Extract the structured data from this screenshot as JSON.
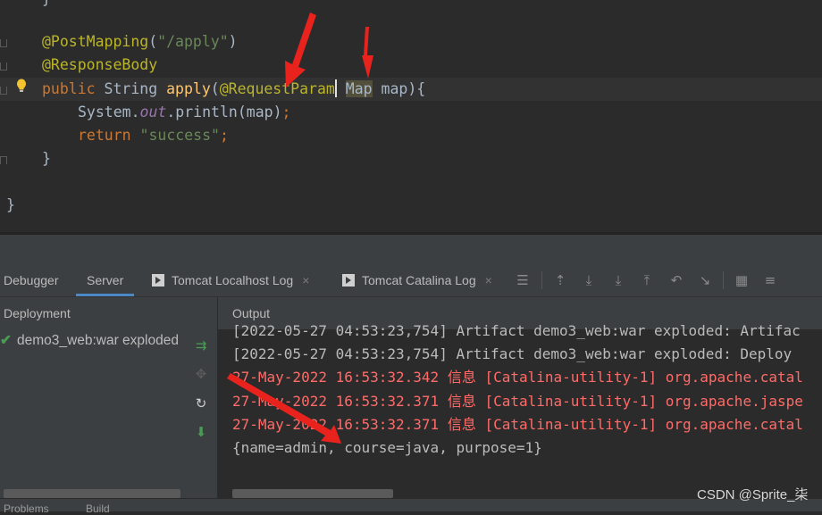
{
  "editor": {
    "lines": {
      "l1_ann": "@PostMapping",
      "l1_open": "(",
      "l1_str": "\"/apply\"",
      "l1_close": ")",
      "l2_ann": "@ResponseBody",
      "l3_kw": "public",
      "l3_type": " String ",
      "l3_fn": "apply",
      "l3_paren": "(",
      "l3_ann": "@RequestParam",
      "l3_space": " ",
      "l3_map": "Map",
      "l3_rest": " map){",
      "l4_obj": "System.",
      "l4_field": "out",
      "l4_rest": ".println(map)",
      "l4_semi": ";",
      "l5_kw": "return",
      "l5_str": " \"success\"",
      "l5_semi": ";",
      "l6": "}",
      "l8": "}"
    }
  },
  "tool_window": {
    "tabs": [
      {
        "label": "Debugger"
      },
      {
        "label": "Server"
      },
      {
        "label": "Tomcat Localhost Log"
      },
      {
        "label": "Tomcat Catalina Log"
      }
    ],
    "close_glyph": "×"
  },
  "deployment": {
    "header": "Deployment",
    "item": "demo3_web:war exploded",
    "check": "✔"
  },
  "output": {
    "header": "Output",
    "lines": [
      "[2022-05-27 04:53:23,754] Artifact demo3_web:war exploded: Artifac",
      "[2022-05-27 04:53:23,754] Artifact demo3_web:war exploded: Deploy",
      "27-May-2022 16:53:32.342 信息 [Catalina-utility-1] org.apache.catal",
      "27-May-2022 16:53:32.371 信息 [Catalina-utility-1] org.apache.jaspe",
      "27-May-2022 16:53:32.371 信息 [Catalina-utility-1] org.apache.catal",
      "{name=admin, course=java, purpose=1}"
    ]
  },
  "bottom": {
    "left": "Problems",
    "right": "Build"
  },
  "watermark": "CSDN @Sprite_柒",
  "colors": {
    "annotation": "#bbb529",
    "keyword": "#cc7832",
    "string": "#6a8759",
    "log_red": "#ff6b68",
    "arrow_red": "#e8231e"
  }
}
